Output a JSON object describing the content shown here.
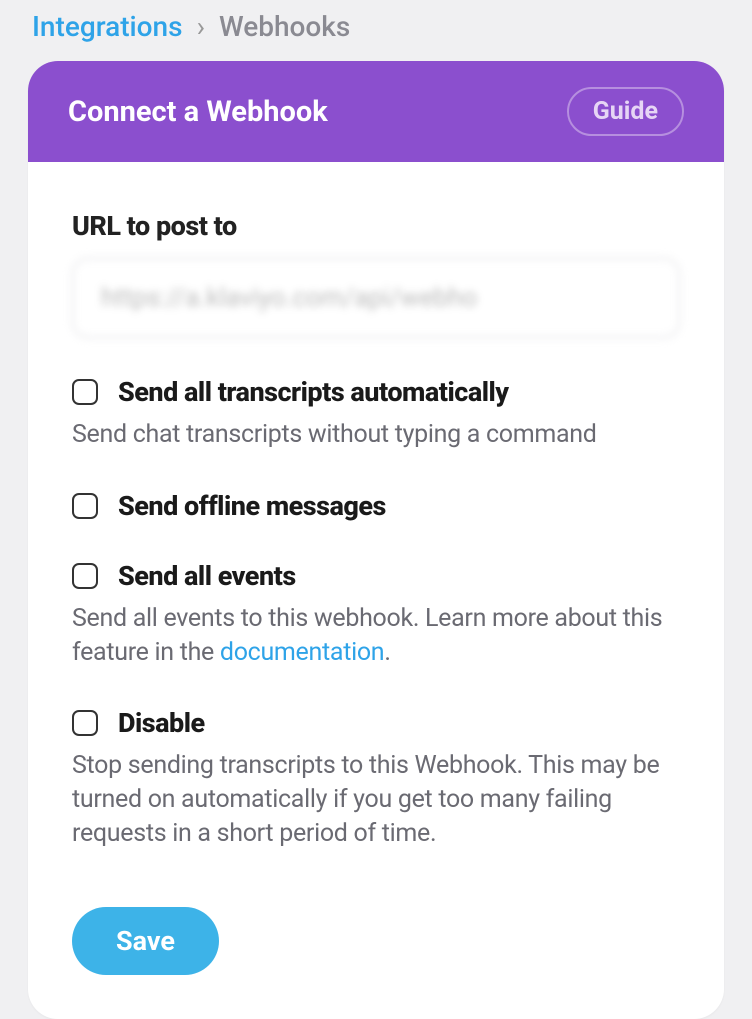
{
  "breadcrumb": {
    "link": "Integrations",
    "separator": "›",
    "current": "Webhooks"
  },
  "card": {
    "title": "Connect a Webhook",
    "guide_label": "Guide"
  },
  "url_section": {
    "label": "URL to post to",
    "value": "https://a.klaviyo.com/api/webho"
  },
  "options": {
    "transcripts": {
      "title": "Send all transcripts automatically",
      "desc": "Send chat transcripts without typing a command"
    },
    "offline": {
      "title": "Send offline messages"
    },
    "events": {
      "title": "Send all events",
      "desc_before": "Send all events to this webhook. Learn more about this feature in the ",
      "link": "documentation",
      "desc_after": "."
    },
    "disable": {
      "title": "Disable",
      "desc": "Stop sending transcripts to this Webhook. This may be turned on automatically if you get too many failing requests in a short period of time."
    }
  },
  "save_label": "Save"
}
